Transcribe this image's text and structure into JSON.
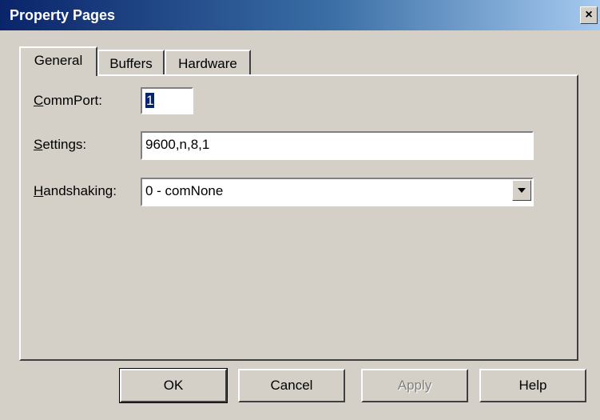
{
  "window": {
    "title": "Property Pages",
    "close_label": "×"
  },
  "tabs": [
    {
      "label": "General",
      "active": true
    },
    {
      "label": "Buffers",
      "active": false
    },
    {
      "label": "Hardware",
      "active": false
    }
  ],
  "form": {
    "commport": {
      "label_prefix": "",
      "label_access": "C",
      "label_rest": "ommPort:",
      "value": "1"
    },
    "settings": {
      "label_access": "S",
      "label_rest": "ettings:",
      "value": "9600,n,8,1"
    },
    "handshaking": {
      "label_access": "H",
      "label_rest": "andshaking:",
      "value": "0 - comNone"
    }
  },
  "buttons": {
    "ok": "OK",
    "cancel": "Cancel",
    "apply": "Apply",
    "help": "Help"
  },
  "colors": {
    "titlebar_start": "#0a246a",
    "titlebar_end": "#a6caf0",
    "face": "#d4d0c8"
  },
  "icons": {
    "close": "close-icon",
    "dropdown": "chevron-down-icon"
  }
}
